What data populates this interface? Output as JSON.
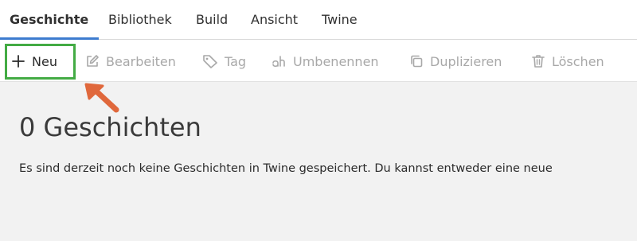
{
  "tabs": [
    {
      "label": "Geschichte",
      "active": true
    },
    {
      "label": "Bibliothek",
      "active": false
    },
    {
      "label": "Build",
      "active": false
    },
    {
      "label": "Ansicht",
      "active": false
    },
    {
      "label": "Twine",
      "active": false
    }
  ],
  "toolbar": {
    "new_label": "Neu",
    "edit_label": "Bearbeiten",
    "tag_label": "Tag",
    "rename_label": "Umbenennen",
    "duplicate_label": "Duplizieren",
    "delete_label": "Löschen"
  },
  "icons": {
    "new": "plus-icon",
    "edit": "pencil-icon",
    "tag": "tag-icon",
    "rename": "rename-icon",
    "duplicate": "copy-icon",
    "delete": "trash-icon"
  },
  "main": {
    "title": "0 Geschichten",
    "text": "Es sind derzeit noch keine Geschichten in Twine gespeichert. Du kannst entweder eine neue"
  },
  "colors": {
    "accent": "#3d7ccf",
    "highlight_box": "#43ab44",
    "arrow": "#e0683c",
    "disabled_text": "#a8a8a8"
  }
}
